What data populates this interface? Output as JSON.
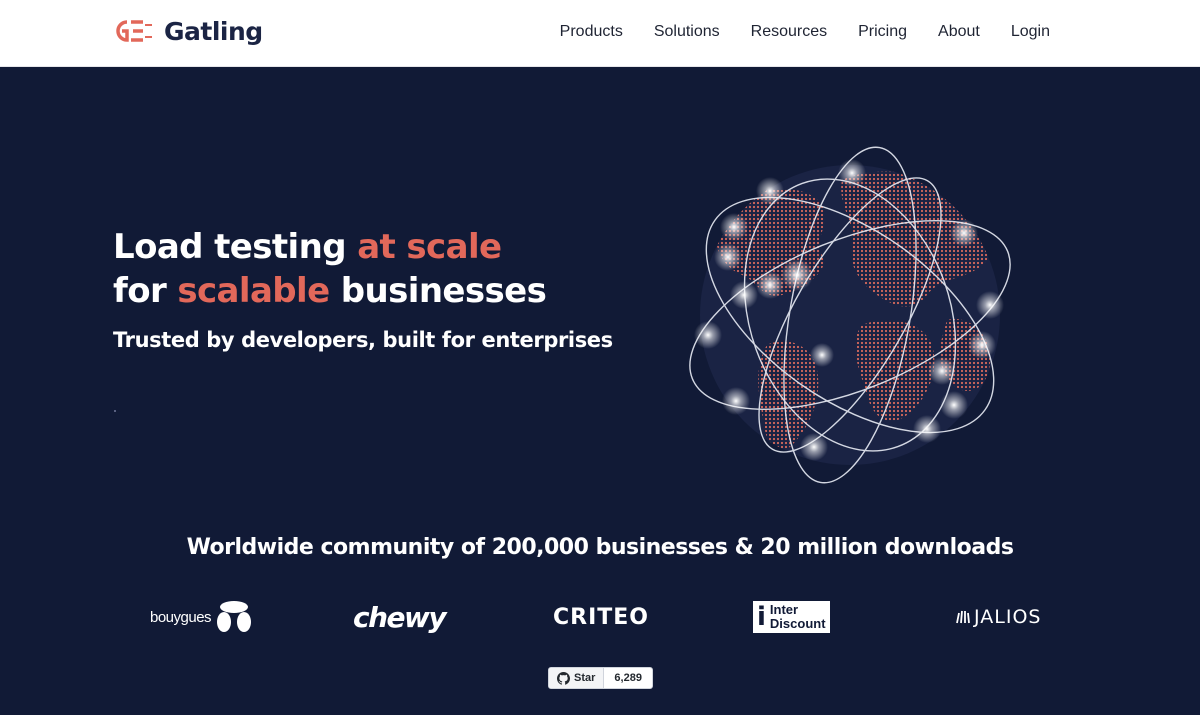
{
  "header": {
    "brand": "Gatling",
    "nav": [
      "Products",
      "Solutions",
      "Resources",
      "Pricing",
      "About",
      "Login"
    ]
  },
  "hero": {
    "headline_line1_plain": "Load testing ",
    "headline_line1_accent": "at scale",
    "headline_line2_plain_start": "for ",
    "headline_line2_accent": "scalable",
    "headline_line2_plain_end": " businesses",
    "subheadline": "Trusted by developers, built for enterprises"
  },
  "community": {
    "text": "Worldwide community of 200,000 businesses & 20 million downloads",
    "logos": {
      "bouygues": "bouygues",
      "chewy": "chewy",
      "criteo": "CRITEO",
      "interdiscount_line1": "Inter",
      "interdiscount_line2": "Discount",
      "jalios": "JALIOS"
    }
  },
  "github": {
    "star_label": "Star",
    "star_count": "6,289"
  },
  "colors": {
    "background": "#111a36",
    "accent": "#e2685a",
    "header_bg": "#ffffff",
    "brand_text": "#1b2444"
  },
  "icons": [
    "gatling-logo-icon",
    "globe-illustration",
    "bouygues-logo-icon",
    "jalios-logo-icon",
    "github-icon"
  ]
}
